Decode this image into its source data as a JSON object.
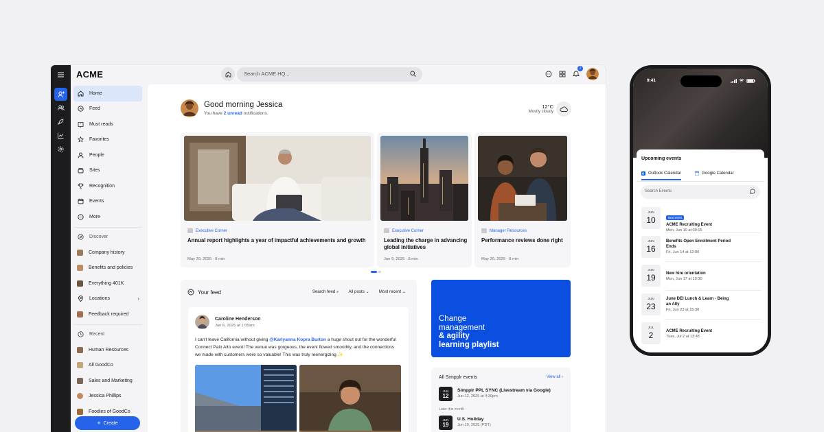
{
  "app": {
    "logo": "ACME",
    "search_placeholder": "Search ACME HQ...",
    "notification_count": "2"
  },
  "sidebar": {
    "items": [
      {
        "label": "Home",
        "icon": "home-icon",
        "active": true
      },
      {
        "label": "Feed",
        "icon": "feed-icon"
      },
      {
        "label": "Must reads",
        "icon": "book-icon"
      },
      {
        "label": "Favorites",
        "icon": "star-icon"
      },
      {
        "label": "People",
        "icon": "person-icon"
      },
      {
        "label": "Sites",
        "icon": "sites-icon"
      },
      {
        "label": "Recognition",
        "icon": "trophy-icon"
      },
      {
        "label": "Events",
        "icon": "calendar-icon"
      },
      {
        "label": "More",
        "icon": "more-icon"
      }
    ],
    "discover_label": "Discover",
    "discover": [
      "Company history",
      "Benefits and policies",
      "Everything 401K",
      "Locations",
      "Feedback required"
    ],
    "recent_label": "Recent",
    "recent": [
      "Human Resources",
      "All GoodCo",
      "Sales and Marketing",
      "Jessica Phillips",
      "Foodies of GoodCo"
    ],
    "create_label": "Create"
  },
  "greeting": {
    "title": "Good morning Jessica",
    "sub_prefix": "You have",
    "sub_count": "2 unread",
    "sub_suffix": "notifications.",
    "temp": "12°C",
    "condition": "Mostly cloudy"
  },
  "articles": [
    {
      "category": "Executive Corner",
      "title": "Annual report highlights a year of impactful achievements and growth",
      "meta": "May 29, 2025 · 8 min"
    },
    {
      "category": "Executive Corner",
      "title": "Leading the charge in advancing global initiatives",
      "meta": "Jun 9, 2025 · 8 min"
    },
    {
      "category": "Manager Resources",
      "title": "Performance reviews done right",
      "meta": "May 29, 2025 · 8 min"
    }
  ],
  "feed": {
    "title": "Your feed",
    "search_label": "Search feed",
    "filter_label": "All posts",
    "sort_label": "Most recent",
    "post": {
      "author": "Caroline Henderson",
      "date": "Jun 6, 2025 at 1:05am",
      "text_before": "I can't leave California without giving",
      "mention": "@Karlyanna Kopra Burton",
      "text_after": "a huge shout out for the wonderful Connect Palo Alto event! The venue was gorgeous, the event flowed smoothly, and the connections we made with customers were so valuable! This was truly reenergizing ✨"
    }
  },
  "promo": {
    "line1": "Change",
    "line2": "management",
    "line3": "& agility",
    "line4": "learning playlist"
  },
  "events": {
    "title": "All Simpplr events",
    "view_all": "View all",
    "later_label": "Later this month",
    "items": [
      {
        "month": "JUN",
        "day": "12",
        "title": "Simpplr PPL SYNC (Livestream via Google)",
        "sub": "Jun 12, 2025 at 4:30pm"
      },
      {
        "month": "JUN",
        "day": "19",
        "title": "U.S. Holiday",
        "sub": "Jun 19, 2025 (PDT)"
      }
    ]
  },
  "phone": {
    "time": "9:41",
    "sheet_title": "Upcoming events",
    "tab_outlook": "Outlook Calendar",
    "tab_google": "Google Calendar",
    "search_placeholder": "Search Events",
    "next_tag": "Next event",
    "events": [
      {
        "month": "JUN",
        "day": "10",
        "title": "ACME Recruiting Event",
        "sub": "Mon, Jun 10 at 09:15"
      },
      {
        "month": "JUN",
        "day": "16",
        "title": "Benefits Open Enrollment Period Ends",
        "sub": "Fri, Jun 14 at 12:00"
      },
      {
        "month": "JUN",
        "day": "19",
        "title": "New hire orientation",
        "sub": "Mon, Jun 17 at 10:30"
      },
      {
        "month": "JUN",
        "day": "23",
        "title": "June DEI Lunch & Learn - Being an Ally",
        "sub": "Fri, Jun 23 at 15:30"
      },
      {
        "month": "JUL",
        "day": "2",
        "title": "ACME Recruiting Event",
        "sub": "Tues, Jul 2 at 13:45"
      }
    ]
  },
  "colors": {
    "accent": "#2563eb",
    "promo": "#0b4fe0",
    "rail": "#1c1c1f"
  }
}
